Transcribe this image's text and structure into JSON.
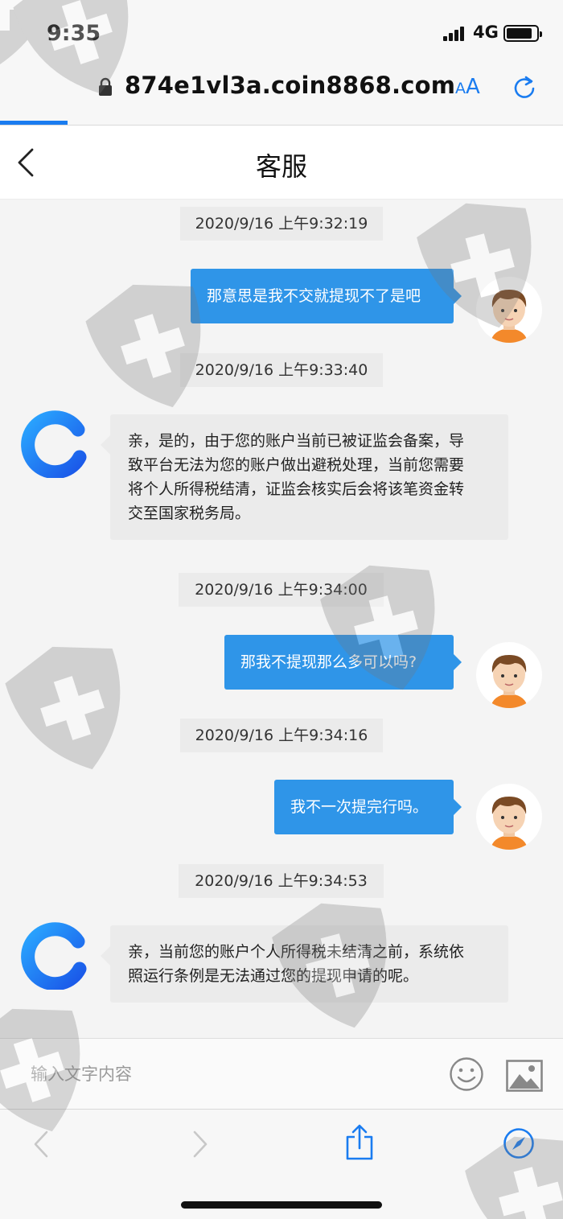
{
  "status_bar": {
    "time": "9:35",
    "network": "4G",
    "battery_level": 0.85
  },
  "browser": {
    "url": "874e1vl3a.coin8868.com",
    "text_size_label_small": "A",
    "text_size_label_large": "A",
    "load_progress": 0.12,
    "accent_color": "#1a7cf0"
  },
  "header": {
    "back_icon": "chevron-left-icon",
    "title": "客服"
  },
  "messages": [
    {
      "kind": "timestamp",
      "text": "2020/9/16 上午9:32:19"
    },
    {
      "kind": "outgoing",
      "text": "那意思是我不交就提现不了是吧"
    },
    {
      "kind": "timestamp",
      "text": "2020/9/16 上午9:33:40"
    },
    {
      "kind": "incoming",
      "lines": [
        "亲，是的，由于您的账户当前已被证监会备案，导",
        "致平台无法为您的账户做出避税处理，当前您需要",
        "将个人所得税结清，证监会核实后会将该笔资金转",
        "交至国家税务局。"
      ]
    },
    {
      "kind": "timestamp",
      "text": "2020/9/16 上午9:34:00"
    },
    {
      "kind": "outgoing",
      "text": "那我不提现那么多可以吗?"
    },
    {
      "kind": "timestamp",
      "text": "2020/9/16 上午9:34:16"
    },
    {
      "kind": "outgoing",
      "text": "我不一次提完行吗。"
    },
    {
      "kind": "timestamp",
      "text": "2020/9/16 上午9:34:53"
    },
    {
      "kind": "incoming",
      "lines": [
        "亲，当前您的账户个人所得税未结清之前，系统依",
        "照运行条例是无法通过您的提现申请的呢。"
      ]
    }
  ],
  "composer": {
    "placeholder": "输入文字内容",
    "emoji_icon": "smiley-icon",
    "image_icon": "image-icon"
  },
  "toolbar": {
    "icons": [
      "back-icon",
      "forward-icon",
      "share-icon",
      "compass-icon"
    ]
  },
  "colors": {
    "outgoing_bubble": "#2f95e8",
    "incoming_bubble": "#ebebeb",
    "timestamp_bg": "#ebebeb"
  }
}
